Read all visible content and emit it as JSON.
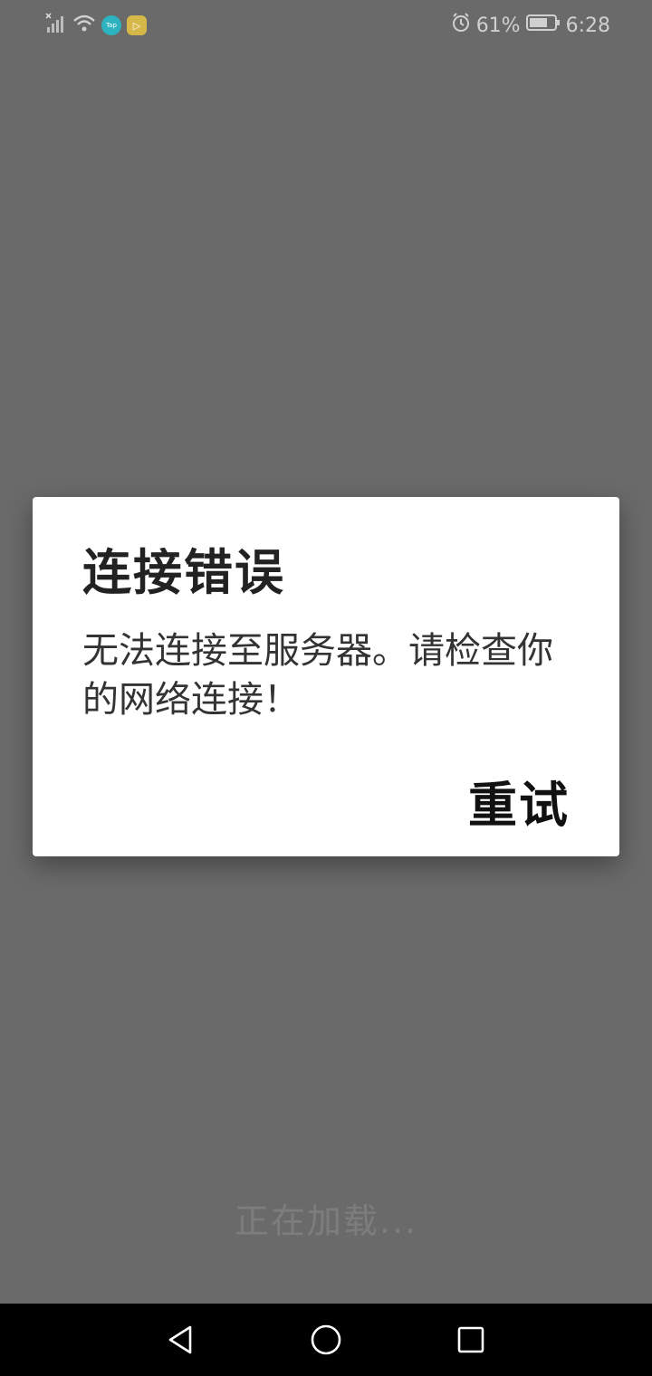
{
  "status_bar": {
    "battery_percent": "61%",
    "time": "6:28",
    "icons": [
      "signal-icon",
      "wifi-icon",
      "tap-app-icon",
      "play-app-icon",
      "alarm-icon",
      "battery-icon"
    ],
    "tap_badge": "Tap",
    "play_badge": "▷"
  },
  "dialog": {
    "title": "连接错误",
    "message": "无法连接至服务器。请检查你的网络连接！",
    "retry_label": "重试"
  },
  "loading": {
    "text": "正在加载..."
  },
  "nav_bar": {
    "icons": [
      "back-icon",
      "home-icon",
      "recents-icon"
    ]
  },
  "colors": {
    "background": "#6a6a6a",
    "dialog_background": "#ffffff",
    "nav_bar": "#000000"
  }
}
